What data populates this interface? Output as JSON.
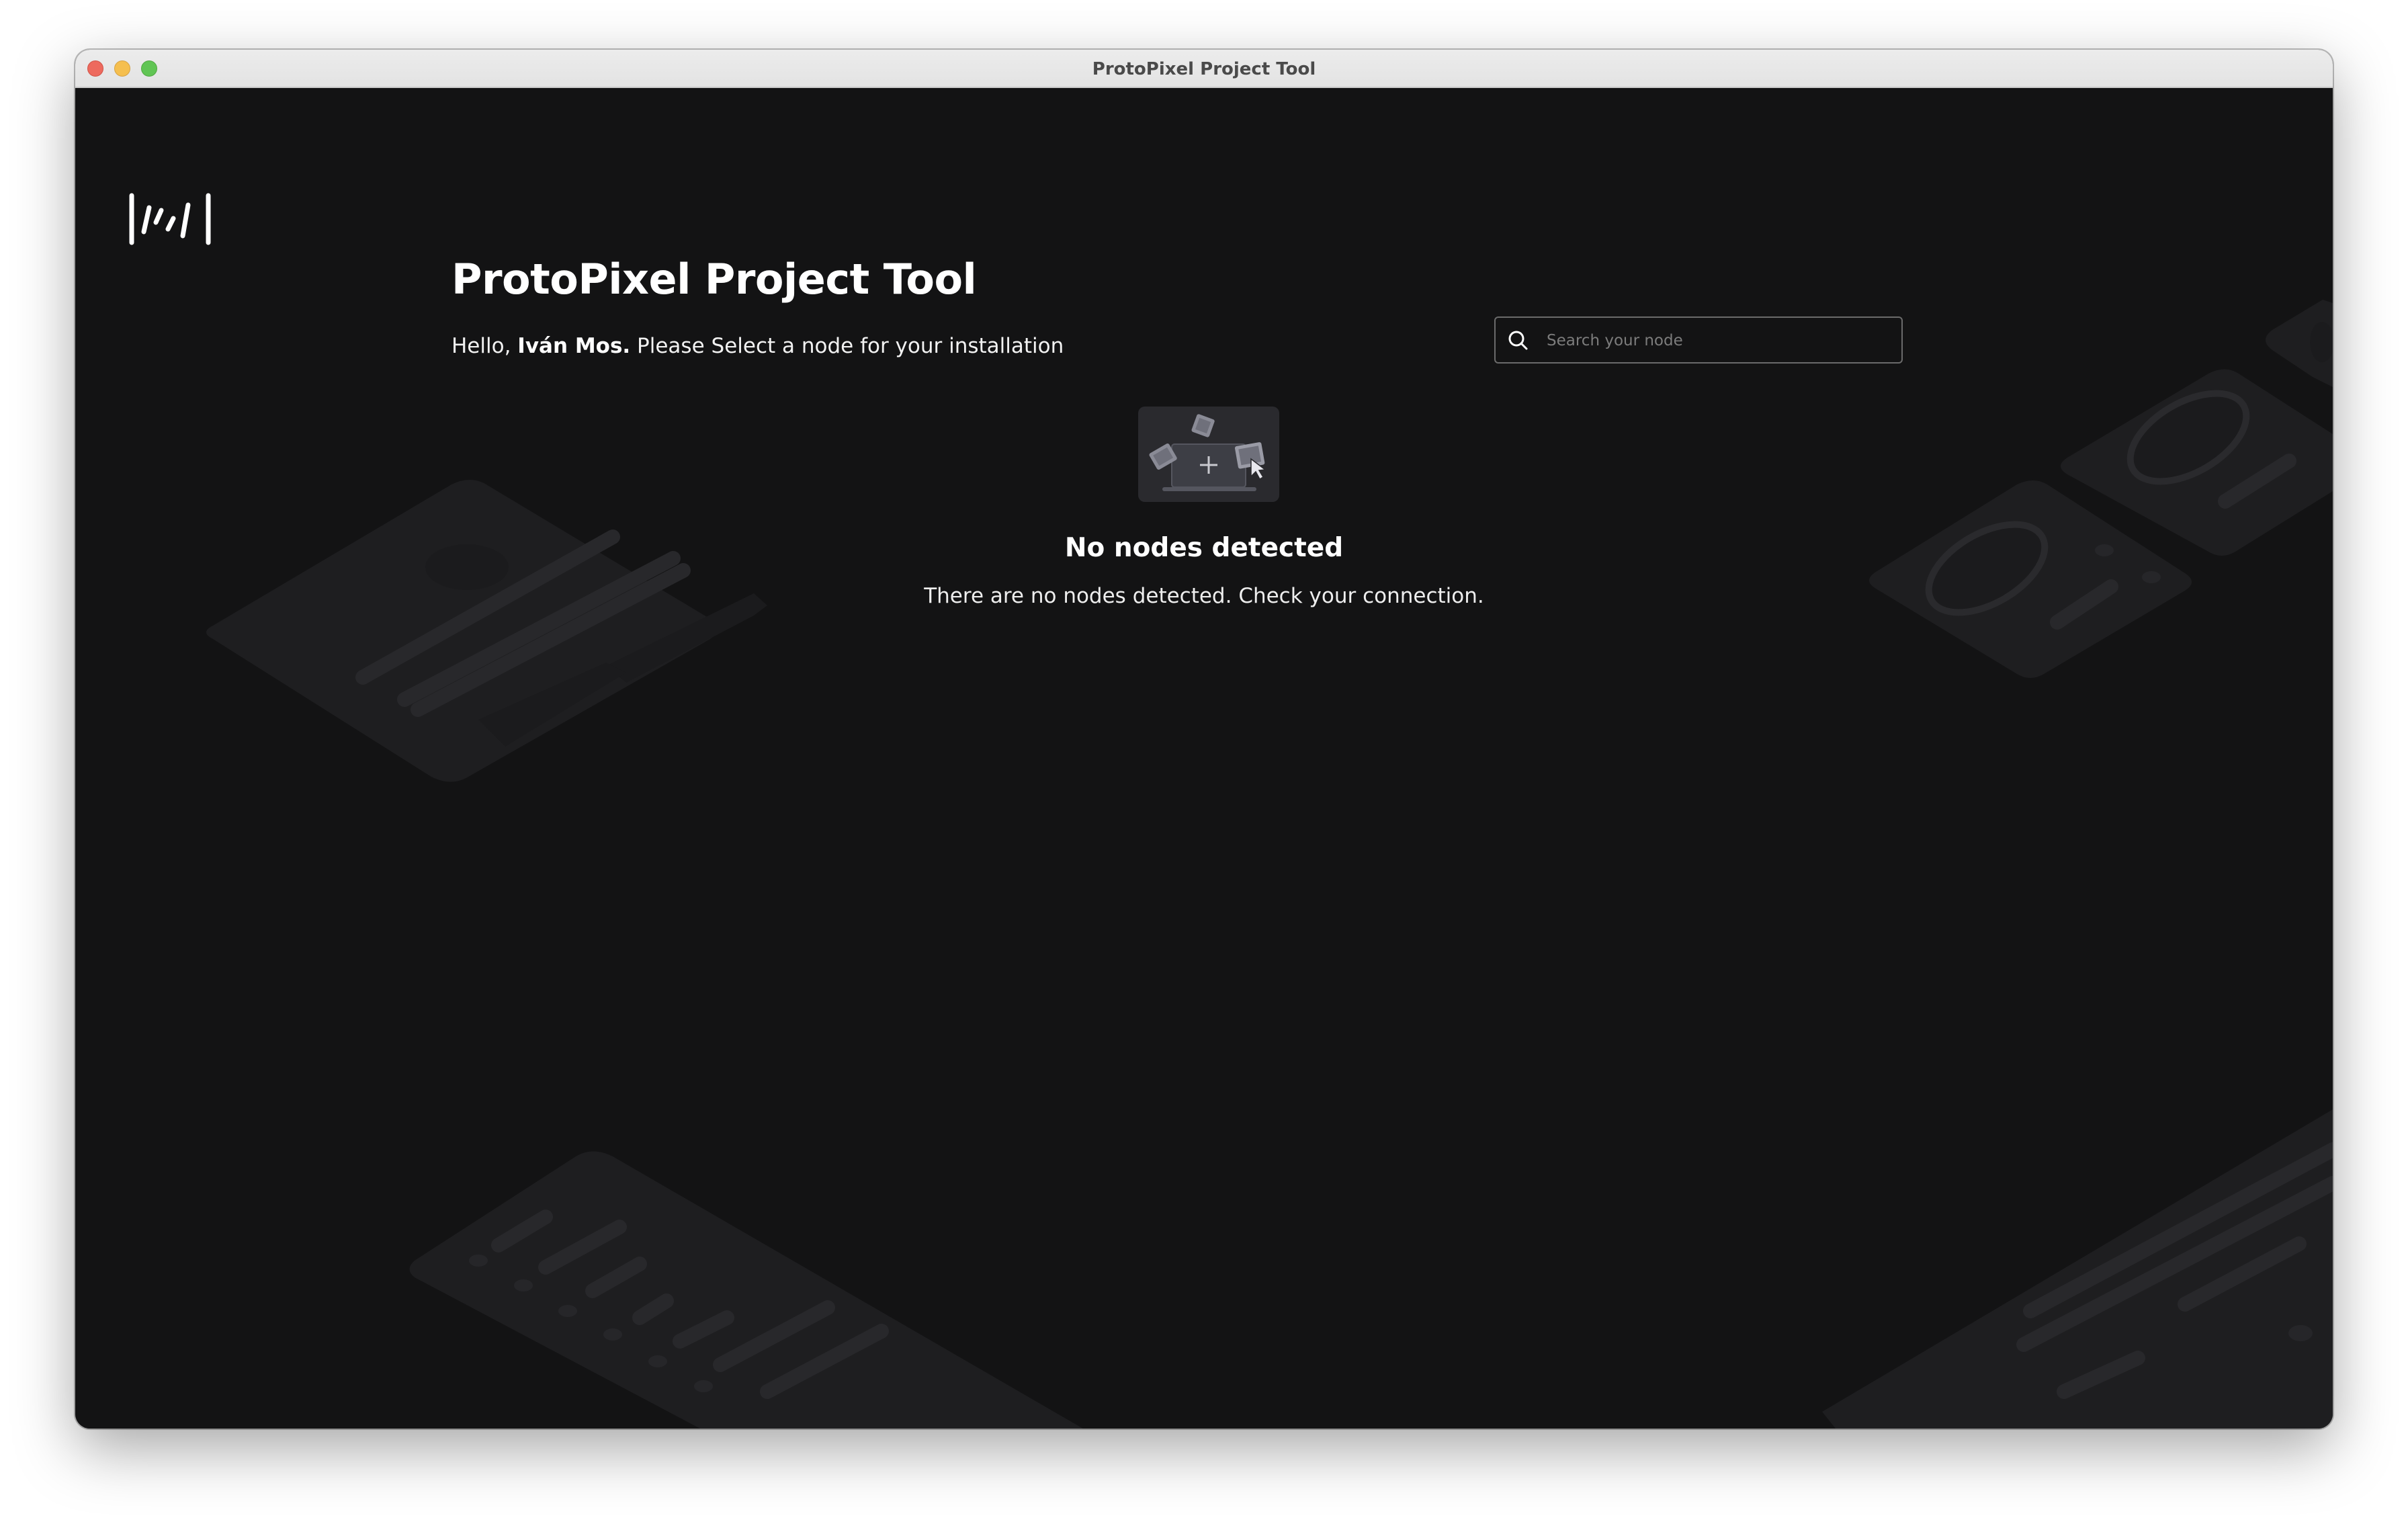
{
  "window": {
    "title": "ProtoPixel Project Tool"
  },
  "header": {
    "app_title": "ProtoPixel Project Tool",
    "greeting_prefix": "Hello, ",
    "user_name": "Iván Mos.",
    "greeting_suffix": " Please Select a node for your installation"
  },
  "search": {
    "placeholder": "Search your node",
    "value": ""
  },
  "empty_state": {
    "title": "No nodes detected",
    "message": "There are no nodes detected. Check your connection."
  },
  "icons": {
    "logo": "protopixel-logo",
    "search": "search-icon",
    "empty_state": "nodes-illustration"
  },
  "colors": {
    "background": "#131314",
    "text": "#ffffff",
    "search_border": "#6b6b6b",
    "decoration": "#1f1f21"
  }
}
